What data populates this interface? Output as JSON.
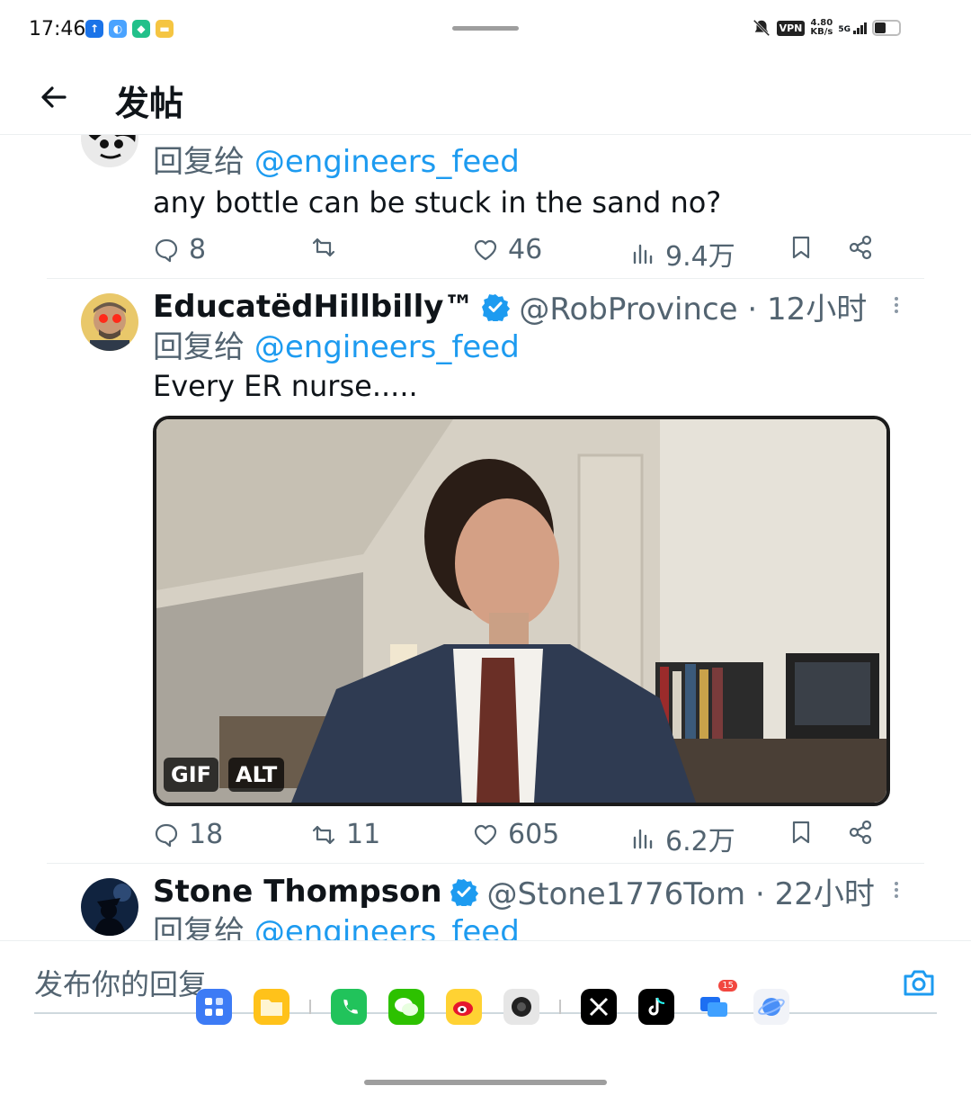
{
  "status_bar": {
    "time": "17:46",
    "vpn": "VPN",
    "net_speed_value": "4.80",
    "net_speed_unit": "KB/s",
    "network": "5G"
  },
  "header": {
    "title": "发帖"
  },
  "tweets": [
    {
      "reply_label": "回复给",
      "reply_to": "@engineers_feed",
      "text": "any bottle can be stuck in the sand no?",
      "stats": {
        "replies": "8",
        "retweets": "",
        "likes": "46",
        "views": "9.4万"
      }
    },
    {
      "author": "EducatëdHillbilly™",
      "handle_time": "@RobProvince · 12小时",
      "reply_label": "回复给",
      "reply_to": "@engineers_feed",
      "text": "Every ER nurse.....",
      "media_badges": [
        "GIF",
        "ALT"
      ],
      "stats": {
        "replies": "18",
        "retweets": "11",
        "likes": "605",
        "views": "6.2万"
      }
    },
    {
      "author": "Stone Thompson",
      "handle_time": "@Stone1776Tom · 22小时",
      "reply_label": "回复给",
      "reply_to": "@engineers_feed"
    }
  ],
  "composer": {
    "placeholder": "发布你的回复"
  },
  "dock": {
    "badge_count": "15"
  },
  "colors": {
    "accent": "#1d9bf0",
    "secondary_text": "#536471",
    "primary_text": "#0f1419"
  }
}
